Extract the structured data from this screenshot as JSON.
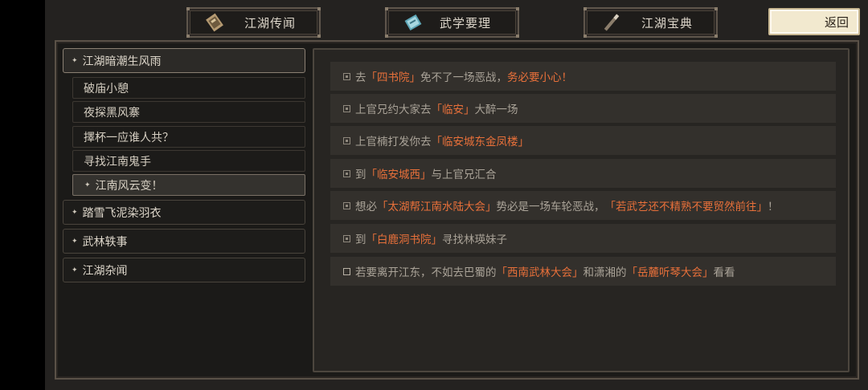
{
  "tabs": [
    {
      "label": "江湖传闻",
      "icon": "scroll-map-icon"
    },
    {
      "label": "武学要理",
      "icon": "manual-book-icon"
    },
    {
      "label": "江湖宝典",
      "icon": "brush-icon"
    }
  ],
  "back_label": "返回",
  "quest_groups": [
    {
      "label": "江湖暗潮生风雨",
      "expanded": true
    },
    {
      "label": "踏雪飞泥染羽衣",
      "expanded": false
    },
    {
      "label": "武林轶事",
      "expanded": false
    },
    {
      "label": "江湖杂闻",
      "expanded": false
    }
  ],
  "sub_quests": [
    {
      "label": "破庙小憩"
    },
    {
      "label": "夜探黑风寨"
    },
    {
      "label": "擇杯一应谁人共？"
    },
    {
      "label": "寻找江南鬼手"
    },
    {
      "label": "江南风云变！"
    }
  ],
  "tasks": [
    {
      "done": true,
      "parts": [
        {
          "t": "去"
        },
        {
          "t": "「四书院」",
          "hl": true
        },
        {
          "t": "免不了一场恶战，"
        },
        {
          "t": "务必要小心！",
          "hl": true
        }
      ]
    },
    {
      "done": true,
      "parts": [
        {
          "t": "上官兄约大家去"
        },
        {
          "t": "「临安」",
          "hl": true
        },
        {
          "t": "大醉一场"
        }
      ]
    },
    {
      "done": true,
      "parts": [
        {
          "t": "上官楠打发你去"
        },
        {
          "t": "「临安城东金凤楼」",
          "hl": true
        }
      ]
    },
    {
      "done": true,
      "parts": [
        {
          "t": "到"
        },
        {
          "t": "「临安城西」",
          "hl": true
        },
        {
          "t": "与上官兄汇合"
        }
      ]
    },
    {
      "done": true,
      "parts": [
        {
          "t": "想必"
        },
        {
          "t": "「太湖帮江南水陆大会」",
          "hl": true
        },
        {
          "t": "势必是一场车轮恶战，"
        },
        {
          "t": "「若武艺还不精熟不要贸然前往」",
          "hl": true
        },
        {
          "t": "！"
        }
      ]
    },
    {
      "done": true,
      "parts": [
        {
          "t": "到"
        },
        {
          "t": "「白鹿洞书院」",
          "hl": true
        },
        {
          "t": "寻找林瑛妹子"
        }
      ]
    },
    {
      "done": false,
      "parts": [
        {
          "t": "若要离开江东，不如去巴蜀的"
        },
        {
          "t": "「西南武林大会」",
          "hl": true
        },
        {
          "t": "和潇湘的"
        },
        {
          "t": "「岳麓听琴大会」",
          "hl": true
        },
        {
          "t": "看看"
        }
      ]
    }
  ],
  "colors": {
    "highlight": "#e8703a",
    "task_text": "#aaa398",
    "back_button": "#f2e9cf"
  }
}
